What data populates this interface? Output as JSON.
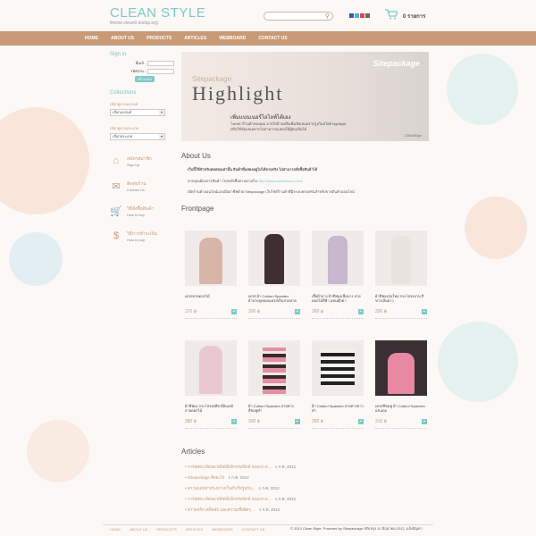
{
  "header": {
    "logo": "CLEAN STYLE",
    "tagline": "theme-clean0.testsp.org",
    "cart_count": "0 รายการ"
  },
  "nav": [
    "HOME",
    "ABOUT US",
    "PRODUCTS",
    "ARTICLES",
    "WEBBOARD",
    "CONTACT US"
  ],
  "sidebar": {
    "signin_title": "Sign in",
    "email_label": "อีเมล์ :",
    "password_label": "รหัสผ่าน :",
    "signin_button": "เข้าระบบ",
    "collections_title": "Collections",
    "brand_label": "เลือกดูตามแบรนด์",
    "brand_select": "เลือกแบรนด์",
    "category_label": "เลือกดูตามประเภท",
    "category_select": "เลือกประเภท",
    "items": [
      {
        "th": "สมัครสมาชิก",
        "en": "Sign Up",
        "icon": "home-icon"
      },
      {
        "th": "ติดต่อร้าน",
        "en": "Contact Us",
        "icon": "mail-icon"
      },
      {
        "th": "วิธีสั่งซื้อสินค้า",
        "en": "How to buy",
        "icon": "cart-icon"
      },
      {
        "th": "วิธีการชำระเงิน",
        "en": "How to pay",
        "icon": "dollar-icon"
      }
    ]
  },
  "banner": {
    "subtitle": "Sitepackage",
    "title": "Highlight",
    "brand": "Sitepackage",
    "line1": "เพิ่มแบนเนอร์ไฮไลท์ได้เอง",
    "line2": "โฆษณาร้านค้าของคุณ อาจใส่บ้านหรือเพิ่มข้อเสนอจากรูปในสไลด์ highlight",
    "line3": "หรือใช้ข้อเสนอหากไม่สามารถแสดงให้ผู้ชมเห็นได้",
    "size": "730x300px"
  },
  "about": {
    "title": "About Us",
    "p1": "เว็บนี้ใช้สำหรับทดสอบเท่านั้น สินค้าที่แสดงอยู่ไม่ได้ขายจริง ไม่สามารถสั่งซื้อสินค้าได้",
    "p2_pre": "หากคุณต้องการสินค้า โปรดสั่งซื้อผ่านทางเว็บ",
    "p2_link": "http://www.siambowoo.com/",
    "p3": "เปิดร้านค้าออนไลน์แบบมืออาชีพด้วย Sitepackage เว็บไซต์ร้านค้าที่มีระบบครบครันสำหรับขายสินค้าออนไลน์"
  },
  "frontpage": {
    "title": "Frontpage",
    "products": [
      {
        "name": "เดรสลายดอกไม้",
        "price": "370 ฿"
      },
      {
        "name": "เดรส ผ้า Cotton+Spandex ผ้าลายจุดขอบเดรสเป็นลวดลาย",
        "price": "300 ฿"
      },
      {
        "name": "เสื้อผ้าบาง ผ้าชีฟองเนื้อบาง ลายดอกไม้สีฟ้า แขนตุ๊กตา",
        "price": "360 ฿"
      },
      {
        "name": "ผ้าชีฟองรุ่นใหม่ กระโปรงบาน สีขาวเส้นยาว",
        "price": "290 ฿"
      },
      {
        "name": "ผ้าชีฟอง กระโปรงพลีท มีอินเลย์ลายดอกไม้",
        "price": "380 ฿"
      },
      {
        "name": "ผ้า Cotton+Spandex ลายทาง สีชมพูดำ",
        "price": "300 ฿"
      },
      {
        "name": "ผ้า Cotton+Spandex ลายทางขาวดำ",
        "price": "300 ฿"
      },
      {
        "name": "เดรสสีชมพู ผ้า Cotton+Spandex แขนกุด",
        "price": "310 ฿"
      }
    ]
  },
  "articles": {
    "title": "Articles",
    "items": [
      {
        "title": "การจดทะเบียนพาณิชย์อิเล็กทรอนิกส์ Search E...",
        "date": "1 ก.ค. 2012"
      },
      {
        "title": "Sitepackage คืออะไร",
        "date": "1 ก.ค. 2012"
      },
      {
        "title": "ความแตกต่างระหว่างเว็บสำเร็จรูปกับ...",
        "date": "1 ก.ค. 2012"
      },
      {
        "title": "การจดทะเบียนพาณิชย์อิเล็กทรอนิกส์ Search E...",
        "date": "1 ก.ค. 2012"
      },
      {
        "title": "ความจริง เคล็ดลับ และความเชื่อผิดๆ ...",
        "date": "1 ก.ค. 2012"
      }
    ]
  },
  "footer": {
    "nav": [
      "HOME",
      "ABOUT US",
      "PRODUCTS",
      "ARTICLES",
      "WEBBOARD",
      "CONTACT US"
    ],
    "copyright": "© 2012 Clean Style. Powered by Sitepackage ปรับปรุง 10 มิถุนายน 2012, แจ้งปัญหา"
  },
  "colors": {
    "accent": "#7ccac6",
    "brand": "#c89a76"
  }
}
